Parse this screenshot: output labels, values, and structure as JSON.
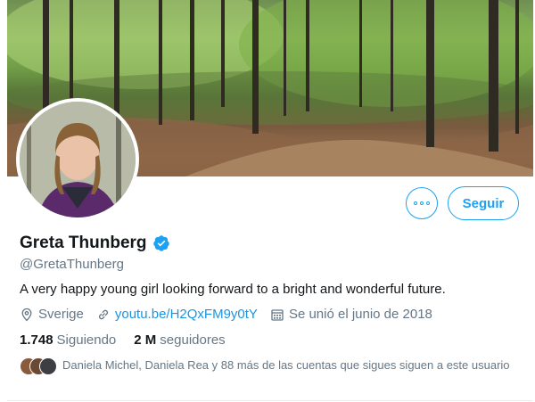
{
  "profile": {
    "display_name": "Greta Thunberg",
    "verified": true,
    "handle": "@GretaThunberg",
    "bio": "A very happy young girl looking forward to a bright and wonderful future.",
    "location": "Sverige",
    "website": "youtu.be/H2QxFM9y0tY",
    "joined": "Se unió el junio de 2018"
  },
  "actions": {
    "follow_label": "Seguir"
  },
  "stats": {
    "following_count": "1.748",
    "following_label": "Siguiendo",
    "followers_count": "2 M",
    "followers_label": "seguidores"
  },
  "followers_you_know": {
    "text": "Daniela Michel, Daniela Rea y 88 más de las cuentas que sigues siguen a este usuario"
  },
  "colors": {
    "accent": "#1da1f2",
    "link": "#1b95e0",
    "secondary_text": "#657786",
    "primary_text": "#14171a"
  },
  "icons": {
    "more": "more-dots-icon",
    "verified": "verified-badge-icon",
    "location": "location-pin-icon",
    "link": "link-icon",
    "calendar": "calendar-icon"
  }
}
